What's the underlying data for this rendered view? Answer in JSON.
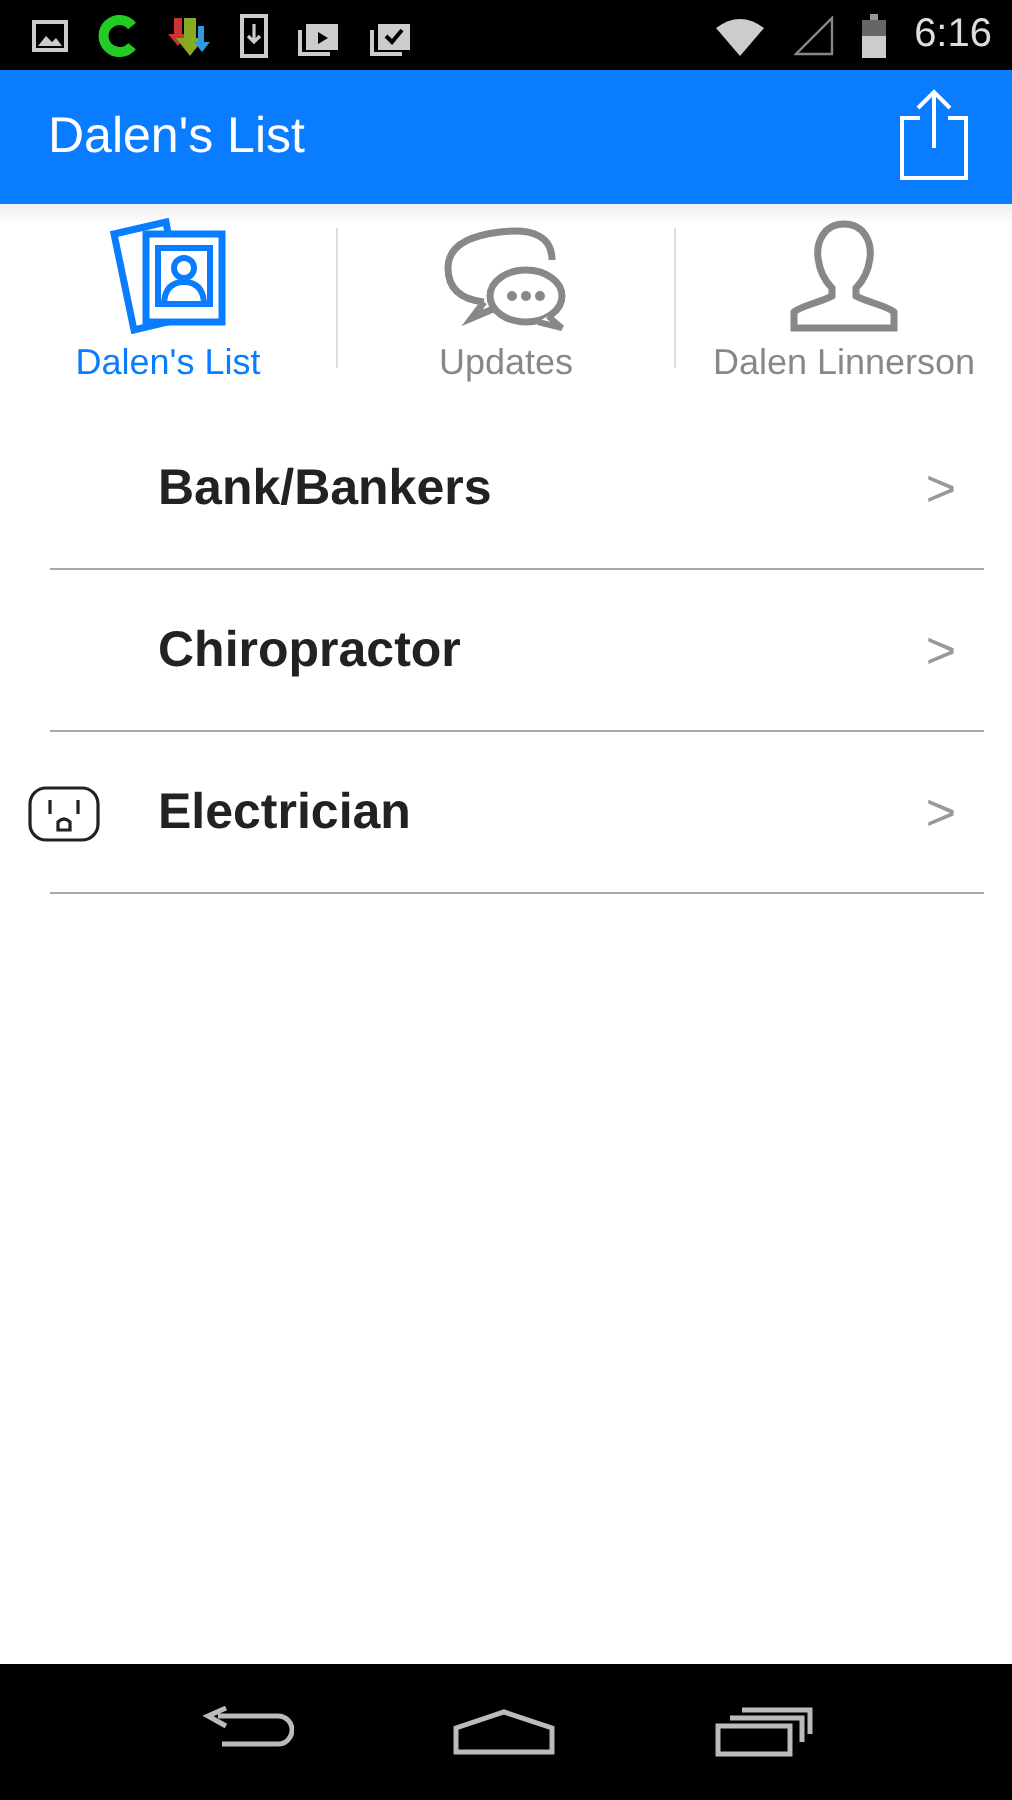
{
  "status_bar": {
    "time": "6:16"
  },
  "app_bar": {
    "title": "Dalen's List"
  },
  "tabs": [
    {
      "label": "Dalen's List",
      "kind": "photos",
      "selected": true
    },
    {
      "label": "Updates",
      "kind": "chat",
      "selected": false
    },
    {
      "label": "Dalen Linnerson",
      "kind": "person",
      "selected": false
    }
  ],
  "list": [
    {
      "label": "Bank/Bankers",
      "chevron": ">",
      "kind": "plain"
    },
    {
      "label": "Chiropractor",
      "chevron": ">",
      "kind": "plain"
    },
    {
      "label": "Electrician",
      "chevron": ">",
      "kind": "outlet"
    }
  ]
}
